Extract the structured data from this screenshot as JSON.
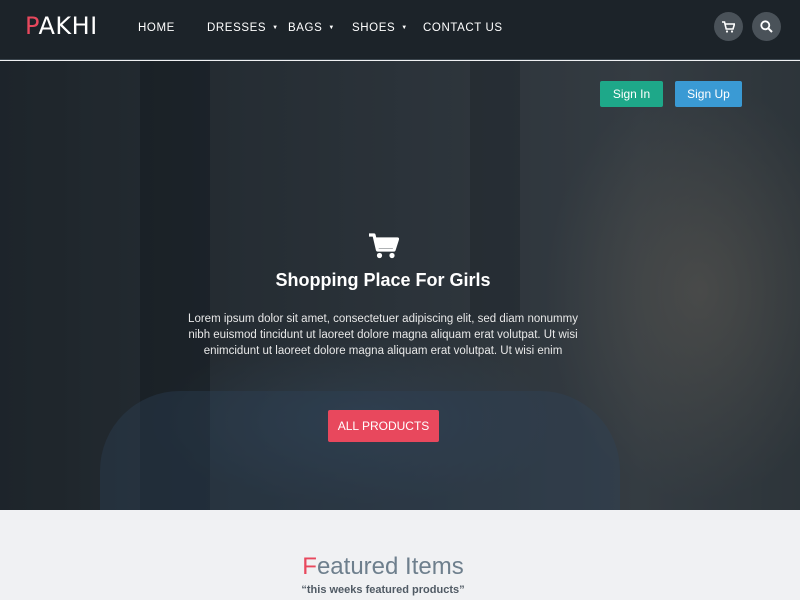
{
  "header": {
    "logo_first": "P",
    "logo_rest": "AKHI",
    "nav": [
      {
        "label": "HOME",
        "has_dropdown": false
      },
      {
        "label": "DRESSES",
        "has_dropdown": true
      },
      {
        "label": "BAGS",
        "has_dropdown": true
      },
      {
        "label": "SHOES",
        "has_dropdown": true
      },
      {
        "label": "CONTACT US",
        "has_dropdown": false
      }
    ],
    "icons": [
      "cart-icon",
      "search-icon"
    ]
  },
  "hero": {
    "signin_label": "Sign In",
    "signup_label": "Sign Up",
    "title": "Shopping Place For Girls",
    "text": "Lorem ipsum dolor sit amet, consectetuer adipiscing elit, sed diam nonummy nibh euismod tincidunt ut laoreet dolore magna aliquam erat volutpat. Ut wisi enimcidunt ut laoreet dolore magna aliquam erat volutpat. Ut wisi enim",
    "button_label": "ALL PRODUCTS"
  },
  "featured": {
    "title_first": "F",
    "title_rest": "eatured Items",
    "subtitle": "“this weeks featured products”"
  },
  "colors": {
    "accent": "#e8485d",
    "signin": "#1ea889",
    "signup": "#3a9ad4",
    "navbar": "#1c2329"
  }
}
